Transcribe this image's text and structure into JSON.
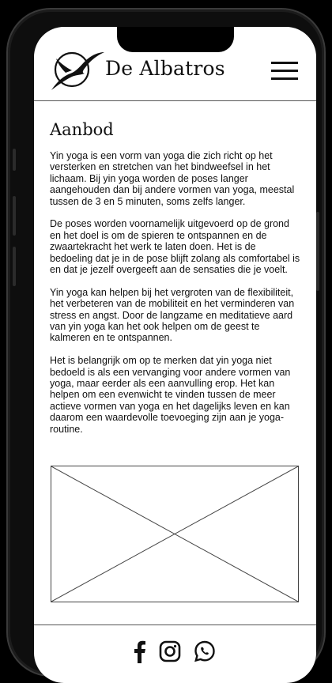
{
  "header": {
    "brand": "De Albatros",
    "logo_icon": "albatross-logo-icon",
    "menu_icon": "hamburger-menu-icon"
  },
  "main": {
    "title": "Aanbod",
    "paragraphs": [
      "Yin yoga is een vorm van yoga die zich richt op het versterken en stretchen van het bindweefsel in het lichaam. Bij yin yoga worden de poses langer aangehouden dan bij andere vormen van yoga, meestal tussen de 3 en 5 minuten, soms zelfs langer.",
      "De poses worden voornamelijk uitgevoerd op de grond en het doel is om de spieren te ontspannen en de zwaartekracht het werk te laten doen. Het is de bedoeling dat je in de pose blijft zolang als comfortabel is en dat je jezelf overgeeft aan de sensaties die je voelt.",
      "Yin yoga kan helpen bij het vergroten van de flexibiliteit, het verbeteren van de mobiliteit en het verminderen van stress en angst. Door de langzame en meditatieve aard van yin yoga kan het ook helpen om de geest te kalmeren en te ontspannen.",
      "Het is belangrijk om op te merken dat yin yoga niet bedoeld is als een vervanging voor andere vormen van yoga, maar eerder als een aanvulling erop. Het kan helpen om een evenwicht te vinden tussen de meer actieve vormen van yoga en het dagelijks leven en kan daarom een waardevolle toevoeging zijn aan je yoga-routine."
    ]
  },
  "footer": {
    "social_icons": [
      "facebook-icon",
      "instagram-icon",
      "whatsapp-icon"
    ]
  }
}
